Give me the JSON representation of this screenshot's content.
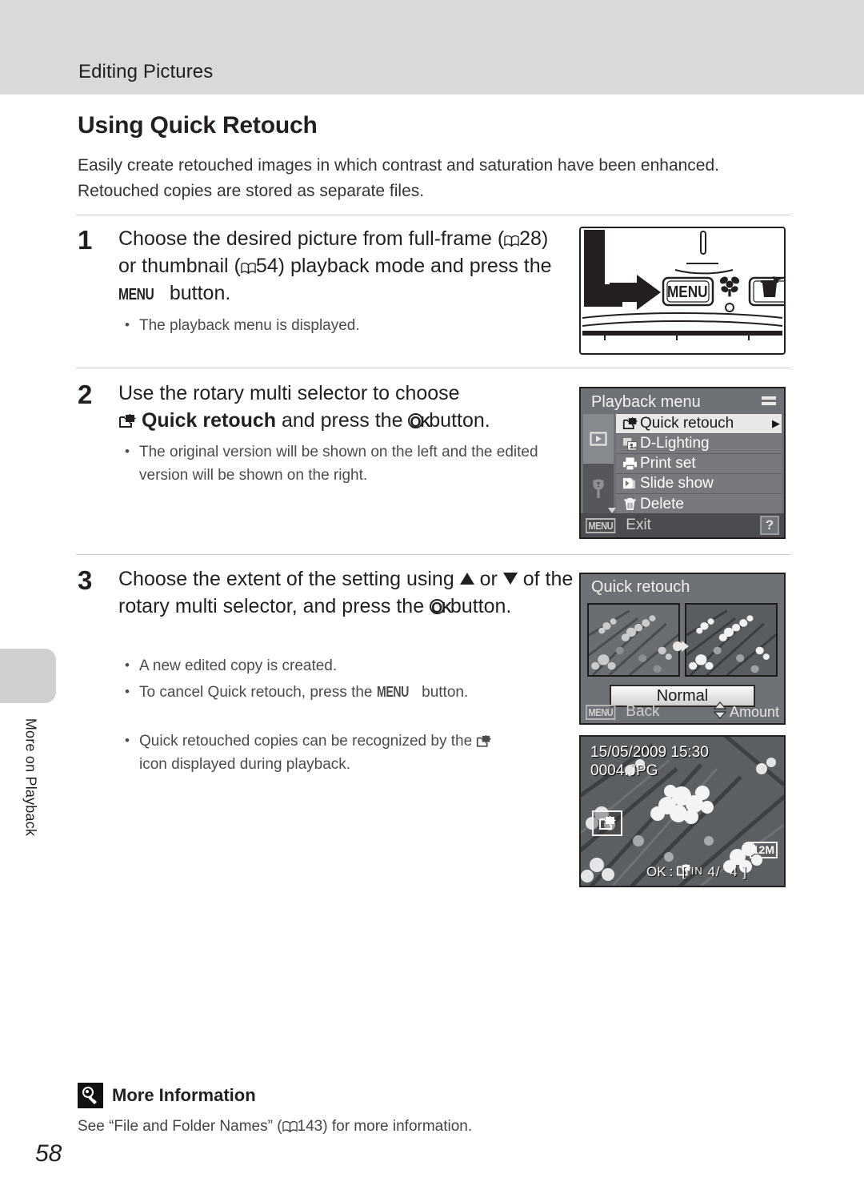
{
  "header": {
    "section_title": "Editing Pictures"
  },
  "spine": {
    "label": "More on Playback",
    "page_number": "58"
  },
  "main": {
    "title": "Using Quick Retouch",
    "intro": "Easily create retouched images in which contrast and saturation have been enhanced. Retouched copies are stored as separate files.",
    "steps": [
      {
        "number": "1",
        "head_parts": {
          "p1": "Choose the desired picture from full-frame (",
          "ref1": "28",
          "p2": ") or thumbnail (",
          "ref2": "54",
          "p3": ") playback mode and press the ",
          "menu": "MENU",
          "p4": " button."
        },
        "bullets": [
          "The playback menu is displayed."
        ]
      },
      {
        "number": "2",
        "head_parts": {
          "p1": "Use the rotary multi selector to choose ",
          "bold": "Quick retouch",
          "p2": " and press the ",
          "ok": "OK",
          "p3": " button."
        },
        "bullets": [
          "The original version will be shown on the left and the edited version will be shown on the right."
        ]
      },
      {
        "number": "3",
        "head_parts": {
          "p1": "Choose the extent of the setting using ",
          "or": " or ",
          "p2": " of the rotary multi selector, and press the ",
          "ok": "OK",
          "p3": " button."
        },
        "bullets": [
          "A new edited copy is created.",
          "To cancel Quick retouch, press the MENU button.",
          "Quick retouched copies can be recognized by the  icon displayed during playback."
        ],
        "bullet2_parts": {
          "a": "To cancel Quick retouch, press the ",
          "menu": "MENU",
          "b": " button."
        },
        "bullet3_parts": {
          "a": "Quick retouched copies can be recognized by the ",
          "b": "icon displayed during playback."
        }
      }
    ]
  },
  "figures": {
    "camera": {
      "menu_button_label": "MENU",
      "macro_icon": "flower-macro-icon",
      "delete_button_icon": "trash-icon",
      "pointer_icon": "right-arrow-icon"
    },
    "playback_menu": {
      "title": "Playback menu",
      "tabs": [
        {
          "name": "playback-tab",
          "icon": "play-icon",
          "active": true
        },
        {
          "name": "setup-tab",
          "icon": "wrench-icon",
          "active": false
        }
      ],
      "items": [
        {
          "label": "Quick retouch",
          "icon": "quick-retouch-icon",
          "selected": true,
          "caret": "▶"
        },
        {
          "label": "D-Lighting",
          "icon": "d-lighting-icon",
          "selected": false,
          "caret": ""
        },
        {
          "label": "Print set",
          "icon": "printer-icon",
          "selected": false,
          "caret": ""
        },
        {
          "label": "Slide show",
          "icon": "slide-show-icon",
          "selected": false,
          "caret": ""
        },
        {
          "label": "Delete",
          "icon": "trash-icon",
          "selected": false,
          "caret": ""
        }
      ],
      "footer": {
        "menu_chip": "MENU",
        "exit_label": "Exit",
        "help_label": "?"
      }
    },
    "quick_retouch_screen": {
      "title": "Quick retouch",
      "amount_value": "Normal",
      "footer_back_chip": "MENU",
      "footer_back_label": "Back",
      "footer_amount_label": "Amount"
    },
    "playback_image": {
      "datetime": "15/05/2009 15:30",
      "filename": "0004.JPG",
      "badge_icon": "quick-retouch-icon",
      "ok_label": "OK",
      "ok_sep": ":",
      "storage": "IN",
      "counter": "4/",
      "counter_total": "4",
      "image_size": "12M"
    }
  },
  "more_information": {
    "badge_icon": "lightbulb-icon",
    "title": "More Information",
    "body_before": "See “File and Folder Names” (",
    "body_ref": "143",
    "body_after": ") for more information."
  }
}
